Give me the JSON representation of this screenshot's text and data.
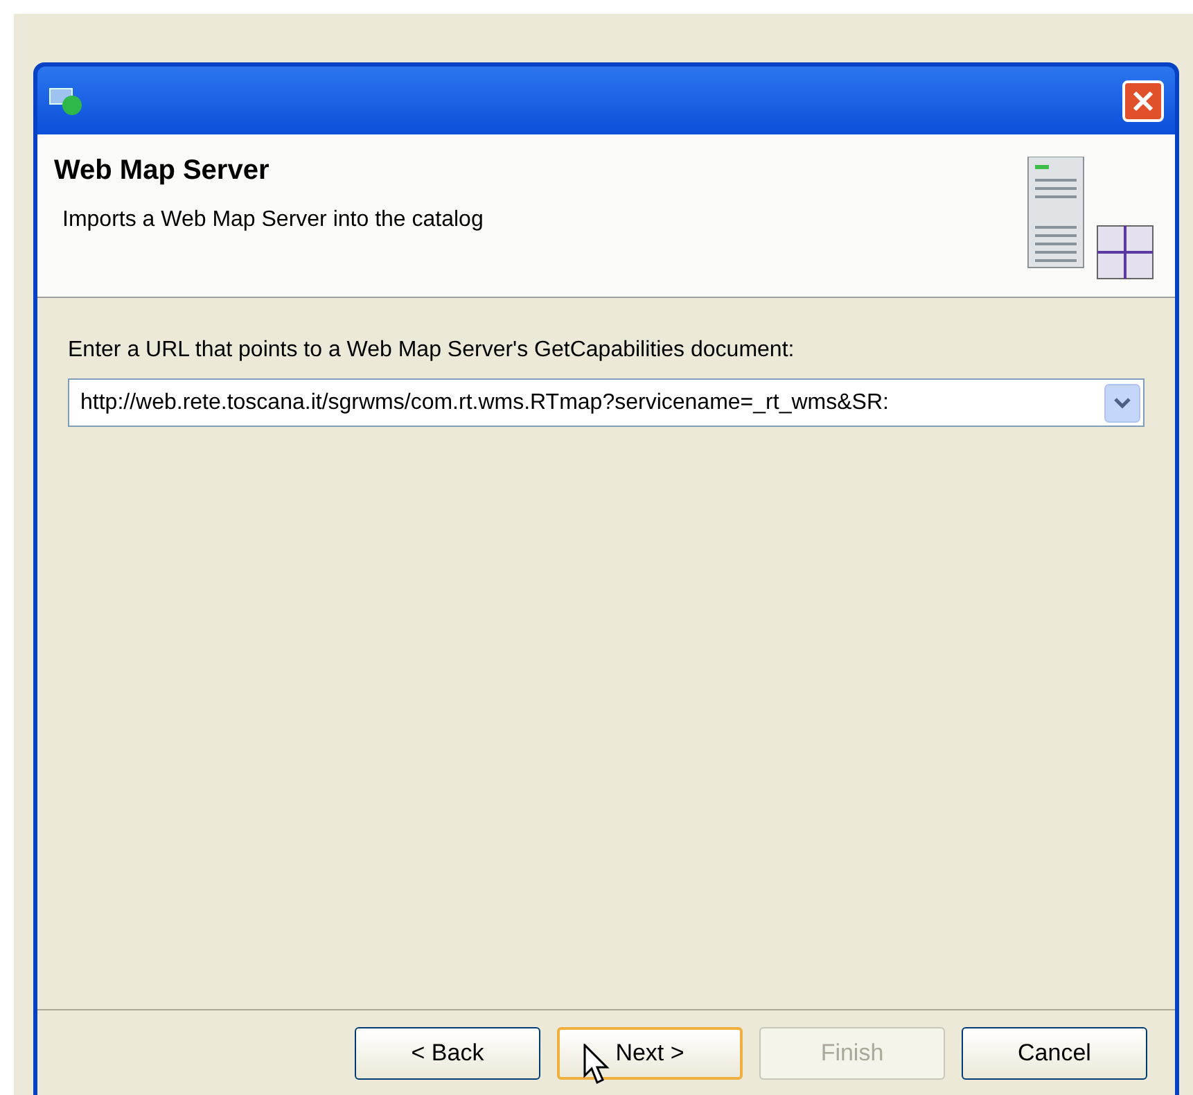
{
  "dialog": {
    "header": {
      "title": "Web Map Server",
      "description": "Imports a Web Map Server into the catalog"
    },
    "prompt": "Enter a URL that points to a Web Map Server's GetCapabilities document:",
    "url_field": {
      "value": "http://web.rete.toscana.it/sgrwms/com.rt.wms.RTmap?servicename=_rt_wms&SR:"
    },
    "buttons": [
      {
        "label": "< Back",
        "disabled": false,
        "focused": false
      },
      {
        "label": "Next >",
        "disabled": false,
        "focused": true
      },
      {
        "label": "Finish",
        "disabled": true,
        "focused": false
      },
      {
        "label": "Cancel",
        "disabled": false,
        "focused": false
      }
    ]
  }
}
